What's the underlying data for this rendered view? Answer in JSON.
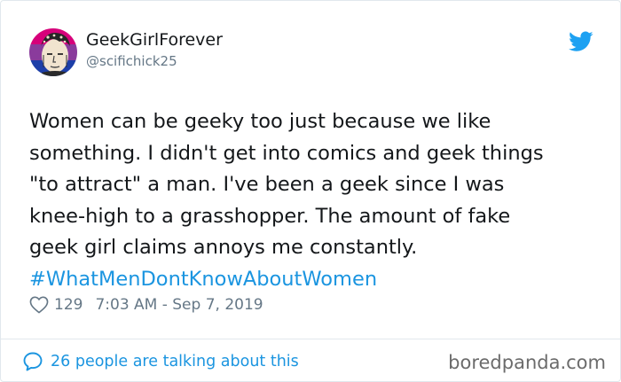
{
  "tweet": {
    "display_name": "GeekGirlForever",
    "handle": "@scifichick25",
    "text_lines": [
      "Women can be geeky too just because we like",
      "something. I didn't get into comics and geek things",
      "\"to attract\" a man. I've been a geek since I was",
      "knee-high to a grasshopper. The amount of fake",
      "geek girl claims annoys me constantly."
    ],
    "hashtag": "#WhatMenDontKnowAboutWomen",
    "likes": "129",
    "timestamp": "7:03 AM - Sep 7, 2019",
    "conversation_link": "26 people are talking about this"
  },
  "watermark": "boredpanda.com",
  "icons": {
    "avatar": "avatar",
    "platform": "twitter-bird-icon",
    "like": "heart-icon",
    "reply": "speech-bubble-icon"
  },
  "colors": {
    "text": "#14171a",
    "secondary": "#657786",
    "link": "#1b95e0",
    "brand_blue": "#1da1f2",
    "border": "#e1e8ed",
    "watermark": "#6b6b6b"
  }
}
